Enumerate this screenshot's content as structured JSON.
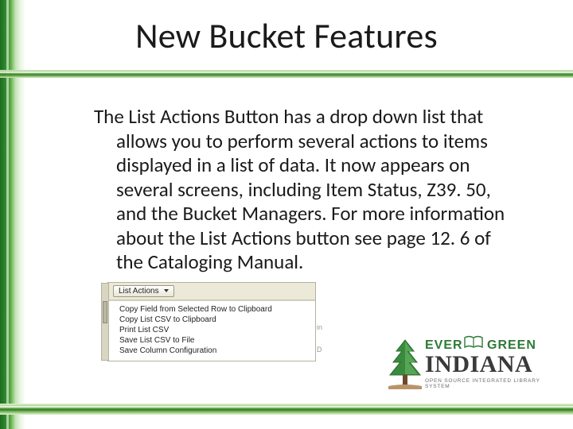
{
  "title": "New Bucket Features",
  "body": "The List Actions Button has a drop down list that allows you to perform several actions to items displayed in a list of data. It now appears on several screens, including Item Status, Z39. 50, and the Bucket Managers. For more information about the List Actions button see page 12. 6 of the Cataloging Manual.",
  "dropdown": {
    "button_label": "List Actions",
    "items": [
      "Copy Field from Selected Row to Clipboard",
      "Copy List CSV to Clipboard",
      "Print List CSV",
      "Save List CSV to File",
      "Save Column Configuration"
    ],
    "ghost_right_1": "in",
    "ghost_right_2": "D"
  },
  "logo": {
    "ever": "EVER",
    "green": "GREEN",
    "indiana": "INDIANA",
    "tagline": "OPEN SOURCE INTEGRATED LIBRARY SYSTEM"
  }
}
